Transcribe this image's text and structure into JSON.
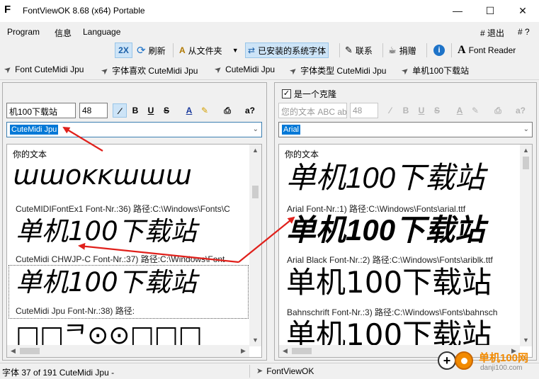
{
  "window": {
    "title": "FontViewOK 8.68  (x64) Portable",
    "app_icon": "F"
  },
  "menu": {
    "items": [
      "Program",
      "信息",
      "Language"
    ],
    "right_exit": "# 退出",
    "right_help": "# ?"
  },
  "toolbar": {
    "zoom_label": "2X",
    "refresh_label": "刷新",
    "from_folder_label": "从文件夹",
    "installed_fonts_label": "已安装的系统字体",
    "contact_label": "联系",
    "donate_label": "捐赠",
    "info_label": "",
    "font_reader_label": "Font Reader"
  },
  "favorites": [
    "Font CuteMidi Jpu",
    "字体喜欢 CuteMidi Jpu",
    "CuteMidi Jpu",
    "字体类型 CuteMidi Jpu",
    "单机100下载站"
  ],
  "left": {
    "text_value": "机100下载站",
    "size_value": "48",
    "font_combo": "CuteMidi Jpu",
    "list_header": "你的文本",
    "top_glyphs": "ɯɯoĸĸɯɯɯ",
    "entries": [
      {
        "sample": "单机100下载站",
        "meta": "CuteMIDIFontEx1 Font-Nr.:36) 路径:C:\\Windows\\Fonts\\C"
      },
      {
        "sample": "单机100下载站",
        "meta": "CuteMidi CHWJP-C Font-Nr.:37) 路径:C:\\Windows\\Font"
      },
      {
        "sample": "单机100下载站",
        "meta": "CuteMidi Jpu Font-Nr.:38) 路径:"
      }
    ],
    "bottom_glyphs": "□□ᄏ⊙⊙□□□"
  },
  "right": {
    "clone_label": "是一个克隆",
    "clone_checked": true,
    "text_placeholder": "您的文本 ABC abc",
    "size_value": "48",
    "font_combo": "Arial",
    "list_header": "你的文本",
    "entries": [
      {
        "sample": "单机100下载站",
        "meta": "Arial Font-Nr.:1) 路径:C:\\Windows\\Fonts\\arial.ttf"
      },
      {
        "sample": "单机100下载站",
        "meta": "Arial Black Font-Nr.:2) 路径:C:\\Windows\\Fonts\\ariblk.ttf"
      },
      {
        "sample": "单机100下载站",
        "meta": "Bahnschrift Font-Nr.:3) 路径:C:\\Windows\\Fonts\\bahnsch"
      },
      {
        "sample": "单机100下载站",
        "meta": ""
      }
    ]
  },
  "status": {
    "left": "字体 37 of 191 CuteMidi Jpu -",
    "app": "FontViewOK"
  },
  "watermark": {
    "name": "单机100网",
    "url": "danji100.com"
  },
  "colors": {
    "accent": "#0078d7",
    "arrow": "#e0201b",
    "active_tool": "#cde4f7"
  }
}
